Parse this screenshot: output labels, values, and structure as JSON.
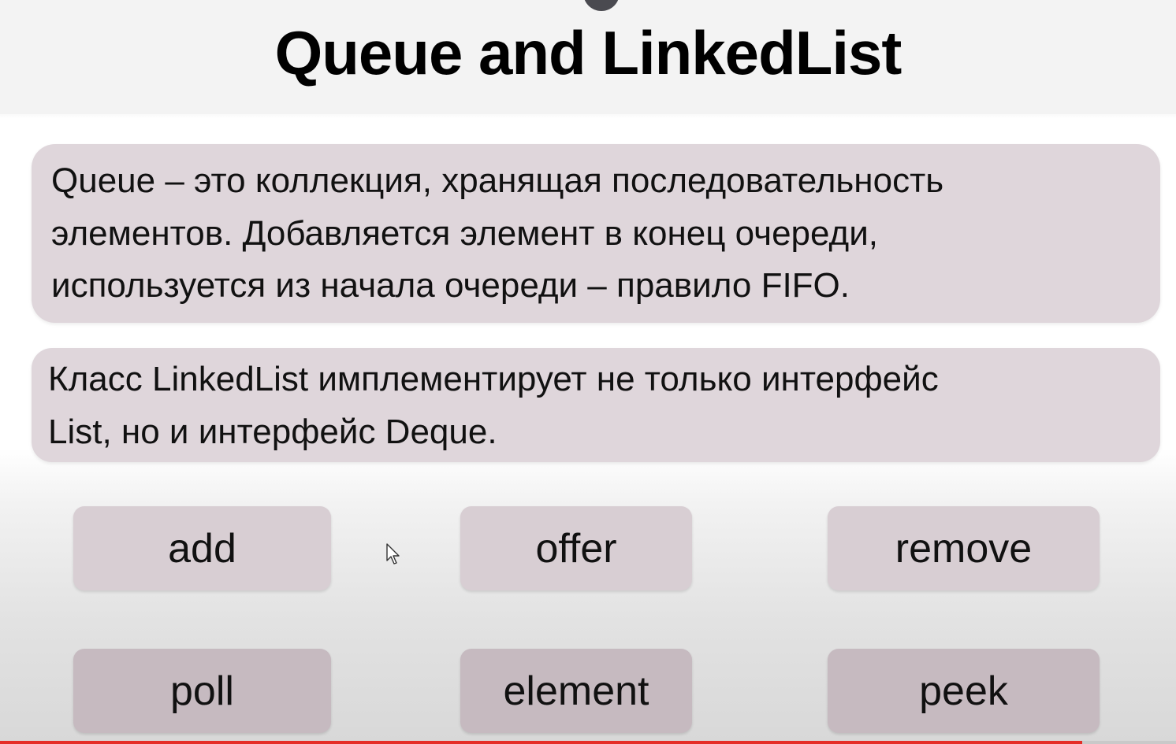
{
  "slide": {
    "title": "Queue and LinkedList",
    "definition_lines": [
      "Queue – это коллекция, хранящая последовательность",
      "элементов. Добавляется элемент в конец очереди,",
      "используется из начала очереди – правило FIFO."
    ],
    "linkedlist_lines": [
      "Класс LinkedList имплементирует не только интерфейс",
      "List, но и интерфейс Deque."
    ],
    "methods": {
      "add": "add",
      "offer": "offer",
      "remove": "remove",
      "poll": "poll",
      "element": "element",
      "peek": "peek"
    }
  },
  "player": {
    "progress": 0.92,
    "progress_color": "#e52d27"
  },
  "colors": {
    "box_background": "#dfd6db",
    "method_row1_background": "#d8ced3",
    "method_row2_background": "#c6bac0"
  }
}
